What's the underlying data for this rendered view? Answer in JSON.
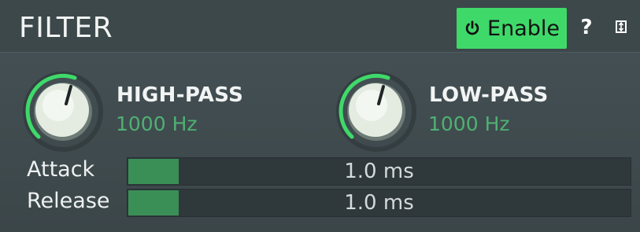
{
  "header": {
    "title": "FILTER",
    "enable_label": "Enable",
    "help_label": "?",
    "accent": "#3fd96a"
  },
  "knobs": [
    {
      "name": "HIGH-PASS",
      "value": "1000 Hz"
    },
    {
      "name": "LOW-PASS",
      "value": "1000 Hz"
    }
  ],
  "sliders": [
    {
      "label": "Attack",
      "value": "1.0 ms",
      "fill_fraction": 0.1
    },
    {
      "label": "Release",
      "value": "1.0 ms",
      "fill_fraction": 0.1
    }
  ],
  "icons": {
    "enable": "power-icon",
    "help": "help-icon",
    "collapse": "collapse-icon"
  },
  "colors": {
    "value_green": "#4fb172",
    "fill_green": "#3a8f56",
    "background": "#3e4a4f"
  }
}
